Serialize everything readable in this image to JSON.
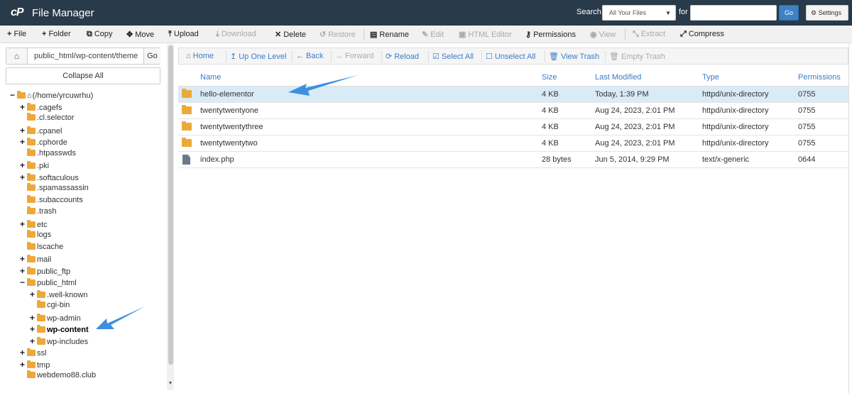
{
  "header": {
    "logo": "cP",
    "title": "File Manager",
    "search_label": "Search",
    "search_scope": "All Your Files",
    "for_label": "for",
    "search_value": "",
    "go_label": "Go",
    "settings_label": "Settings"
  },
  "toolbar": [
    {
      "icon": "plus-icon",
      "glyph": "+",
      "label": "File",
      "enabled": true
    },
    {
      "icon": "plus-icon",
      "glyph": "+",
      "label": "Folder",
      "enabled": true
    },
    {
      "icon": "copy-icon",
      "glyph": "⧉",
      "label": "Copy",
      "enabled": true
    },
    {
      "icon": "move-icon",
      "glyph": "✥",
      "label": "Move",
      "enabled": true
    },
    {
      "icon": "upload-icon",
      "glyph": "⤒",
      "label": "Upload",
      "enabled": true
    },
    {
      "icon": "download-icon",
      "glyph": "⤓",
      "label": "Download",
      "enabled": false
    },
    {
      "icon": "delete-icon",
      "glyph": "✕",
      "label": "Delete",
      "enabled": true
    },
    {
      "icon": "restore-icon",
      "glyph": "↺",
      "label": "Restore",
      "enabled": false
    },
    {
      "icon": "rename-icon",
      "glyph": "▤",
      "label": "Rename",
      "enabled": true
    },
    {
      "icon": "edit-icon",
      "glyph": "✎",
      "label": "Edit",
      "enabled": false
    },
    {
      "icon": "html-editor-icon",
      "glyph": "▣",
      "label": "HTML Editor",
      "enabled": false
    },
    {
      "icon": "key-icon",
      "glyph": "⚷",
      "label": "Permissions",
      "enabled": true
    },
    {
      "icon": "eye-icon",
      "glyph": "◉",
      "label": "View",
      "enabled": false
    },
    {
      "icon": "extract-icon",
      "glyph": "⤡",
      "label": "Extract",
      "enabled": false
    },
    {
      "icon": "compress-icon",
      "glyph": "⤢",
      "label": "Compress",
      "enabled": true
    }
  ],
  "left_panel": {
    "path": "public_html/wp-content/themes",
    "go_label": "Go",
    "collapse_label": "Collapse All",
    "tree": [
      {
        "label": "(/home/yrcuwrhu)",
        "toggle": "−",
        "home": true,
        "active": false
      },
      {
        "label": ".cagefs",
        "toggle": "+",
        "active": false
      },
      {
        "label": ".cl.selector",
        "toggle": "",
        "active": false
      },
      {
        "label": ".cpanel",
        "toggle": "+",
        "active": false
      },
      {
        "label": ".cphorde",
        "toggle": "+",
        "active": false
      },
      {
        "label": ".htpasswds",
        "toggle": "",
        "active": false
      },
      {
        "label": ".pki",
        "toggle": "+",
        "active": false
      },
      {
        "label": ".softaculous",
        "toggle": "+",
        "active": false
      },
      {
        "label": ".spamassassin",
        "toggle": "",
        "active": false
      },
      {
        "label": ".subaccounts",
        "toggle": "",
        "active": false
      },
      {
        "label": ".trash",
        "toggle": "",
        "active": false
      },
      {
        "label": "etc",
        "toggle": "+",
        "active": false
      },
      {
        "label": "logs",
        "toggle": "",
        "active": false
      },
      {
        "label": "lscache",
        "toggle": "",
        "active": false
      },
      {
        "label": "mail",
        "toggle": "+",
        "active": false
      },
      {
        "label": "public_ftp",
        "toggle": "+",
        "active": false
      },
      {
        "label": "public_html",
        "toggle": "−",
        "active": false
      },
      {
        "label": ".well-known",
        "toggle": "+",
        "active": false
      },
      {
        "label": "cgi-bin",
        "toggle": "",
        "active": false
      },
      {
        "label": "wp-admin",
        "toggle": "+",
        "active": false
      },
      {
        "label": "wp-content",
        "toggle": "+",
        "active": true
      },
      {
        "label": "wp-includes",
        "toggle": "+",
        "active": false
      },
      {
        "label": "ssl",
        "toggle": "+",
        "active": false
      },
      {
        "label": "tmp",
        "toggle": "+",
        "active": false
      },
      {
        "label": "webdemo88.club",
        "toggle": "",
        "active": false
      }
    ]
  },
  "nav_bar": [
    {
      "icon": "home-icon",
      "glyph": "⌂",
      "label": "Home",
      "enabled": true
    },
    {
      "icon": "up-level-icon",
      "glyph": "↥",
      "label": "Up One Level",
      "enabled": true
    },
    {
      "icon": "back-icon",
      "glyph": "←",
      "label": "Back",
      "enabled": true
    },
    {
      "icon": "forward-icon",
      "glyph": "→",
      "label": "Forward",
      "enabled": false
    },
    {
      "icon": "reload-icon",
      "glyph": "⟳",
      "label": "Reload",
      "enabled": true
    },
    {
      "icon": "check-square-icon",
      "glyph": "☑",
      "label": "Select All",
      "enabled": true
    },
    {
      "icon": "square-icon",
      "glyph": "☐",
      "label": "Unselect All",
      "enabled": true
    },
    {
      "icon": "trash-icon",
      "glyph": "🗑",
      "label": "View Trash",
      "enabled": true
    },
    {
      "icon": "trash-icon",
      "glyph": "🗑",
      "label": "Empty Trash",
      "enabled": false
    }
  ],
  "file_table": {
    "columns": [
      "Name",
      "Size",
      "Last Modified",
      "Type",
      "Permissions"
    ],
    "rows": [
      {
        "name": "hello-elementor",
        "size": "4 KB",
        "modified": "Today, 1:39 PM",
        "type": "httpd/unix-directory",
        "perms": "0755",
        "kind": "dir",
        "selected": true
      },
      {
        "name": "twentytwentyone",
        "size": "4 KB",
        "modified": "Aug 24, 2023, 2:01 PM",
        "type": "httpd/unix-directory",
        "perms": "0755",
        "kind": "dir",
        "selected": false
      },
      {
        "name": "twentytwentythree",
        "size": "4 KB",
        "modified": "Aug 24, 2023, 2:01 PM",
        "type": "httpd/unix-directory",
        "perms": "0755",
        "kind": "dir",
        "selected": false
      },
      {
        "name": "twentytwentytwo",
        "size": "4 KB",
        "modified": "Aug 24, 2023, 2:01 PM",
        "type": "httpd/unix-directory",
        "perms": "0755",
        "kind": "dir",
        "selected": false
      },
      {
        "name": "index.php",
        "size": "28 bytes",
        "modified": "Jun 5, 2014, 9:29 PM",
        "type": "text/x-generic",
        "perms": "0644",
        "kind": "file",
        "selected": false
      }
    ]
  },
  "colors": {
    "header_bg": "#293a4a",
    "accent": "#3a7bc8",
    "folder": "#eda83a",
    "selected_row": "#d9ebf7",
    "arrow": "#3d8fe0"
  }
}
